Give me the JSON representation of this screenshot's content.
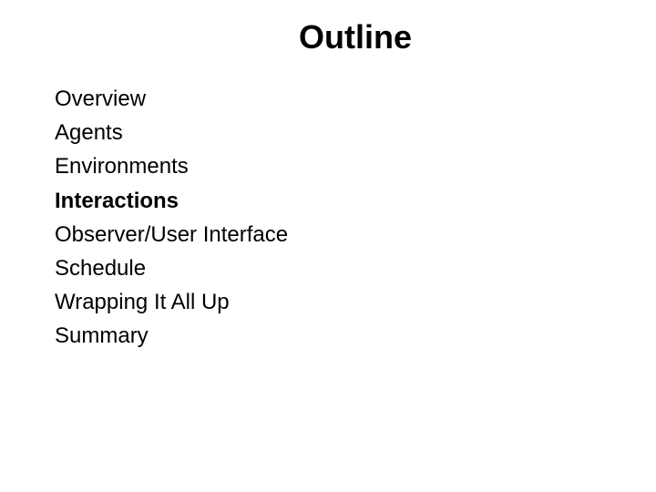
{
  "slide": {
    "title": "Outline",
    "items": [
      {
        "label": "Overview",
        "current": false
      },
      {
        "label": "Agents",
        "current": false
      },
      {
        "label": "Environments",
        "current": false
      },
      {
        "label": "Interactions",
        "current": true
      },
      {
        "label": "Observer/User Interface",
        "current": false
      },
      {
        "label": "Schedule",
        "current": false
      },
      {
        "label": "Wrapping It All Up",
        "current": false
      },
      {
        "label": "Summary",
        "current": false
      }
    ]
  }
}
